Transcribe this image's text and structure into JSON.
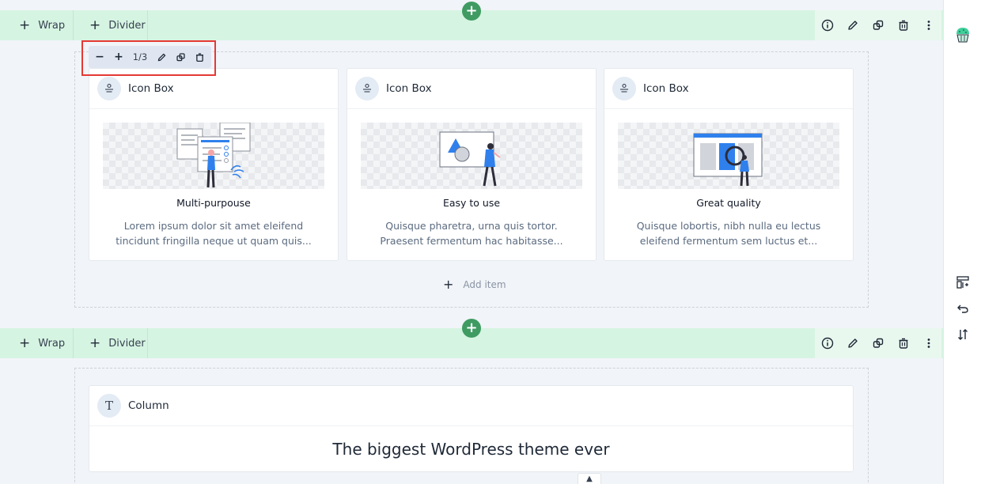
{
  "sections": [
    {
      "wrap_label": "Wrap",
      "divider_label": "Divider"
    },
    {
      "wrap_label": "Wrap",
      "divider_label": "Divider"
    }
  ],
  "column_toolbar": {
    "decrease": "−",
    "increase": "+",
    "ratio": "1/3"
  },
  "cards": [
    {
      "label": "Icon Box",
      "heading": "Multi-purpouse",
      "desc": "Lorem ipsum dolor sit amet eleifend tincidunt fringilla neque ut quam quis..."
    },
    {
      "label": "Icon Box",
      "heading": "Easy to use",
      "desc": "Quisque pharetra, urna quis tortor. Praesent fermentum hac habitasse..."
    },
    {
      "label": "Icon Box",
      "heading": "Great quality",
      "desc": "Quisque lobortis, nibh nulla eu lectus eleifend fermentum sem luctus et..."
    }
  ],
  "add_item_label": "Add item",
  "column_block": {
    "label": "Column",
    "badge_glyph": "T",
    "text": "The biggest WordPress theme ever"
  },
  "colors": {
    "section_bar": "#d6f4e2",
    "add_button": "#3f9b62",
    "highlight": "#e53935",
    "accent_blue": "#2f80ed"
  },
  "icons": {
    "sidebar": [
      "cupcake-logo-icon",
      "layout-add-icon",
      "undo-icon",
      "sort-icon"
    ],
    "section_actions": [
      "info-icon",
      "pencil-icon",
      "copy-icon",
      "trash-icon",
      "more-vertical-icon"
    ]
  }
}
